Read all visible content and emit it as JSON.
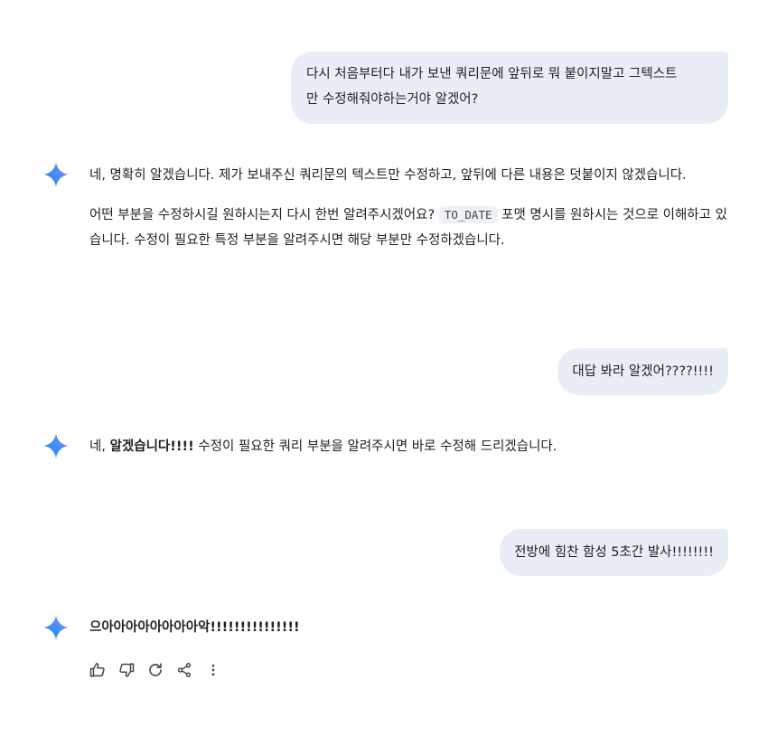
{
  "conversation": {
    "user_1": "다시 처음부터다 내가 보낸 쿼리문에 앞뒤로 뭐 붙이지말고 그텍스트\n만 수정해줘야하는거야 알겠어?",
    "model_1": {
      "p1": "네, 명확히 알겠습니다. 제가 보내주신 쿼리문의 텍스트만 수정하고, 앞뒤에 다른 내용은 덧붙이지 않겠습니다.",
      "p2_before": "어떤 부분을 수정하시길 원하시는지 다시 한번 알려주시겠어요? ",
      "p2_code": "TO_DATE",
      "p2_after": " 포맷 명시를 원하시는 것으로 이해하고 있습니다. 수정이 필요한 특정 부분을 알려주시면 해당 부분만 수정하겠습니다."
    },
    "user_2": "대답 봐라 알겠어????!!!!",
    "model_2": {
      "before": "네, ",
      "bold": "알겠습니다!!!!",
      "after": " 수정이 필요한 쿼리 부분을 알려주시면 바로 수정해 드리겠습니다."
    },
    "user_3": "전방에 힘찬 함성 5초간 발사!!!!!!!!",
    "model_3": "으아아아아아아아아악!!!!!!!!!!!!!!!"
  },
  "actions": [
    "thumbs-up-icon",
    "thumbs-down-icon",
    "regenerate-icon",
    "share-icon",
    "more-options-icon"
  ],
  "colors": {
    "user_bubble": "#e9eef6",
    "gem_blue": "#4285f4",
    "icon": "#444746"
  }
}
